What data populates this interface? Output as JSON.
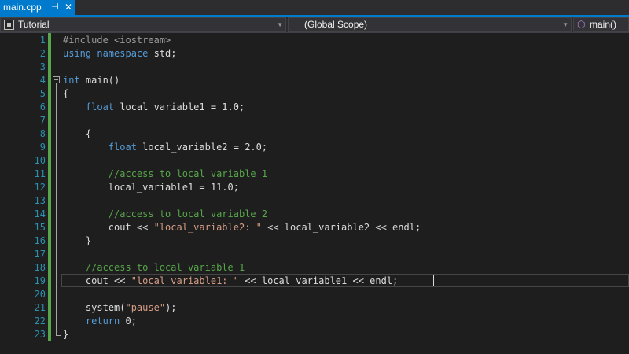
{
  "tab": {
    "title": "main.cpp",
    "pin_glyph": "⊣",
    "close_glyph": "✕"
  },
  "navbar": {
    "project": "Tutorial",
    "scope": "(Global Scope)",
    "member": "main()"
  },
  "colors": {
    "keyword": "#569cd6",
    "preprocessor": "#9b9b9b",
    "string": "#d69d85",
    "comment": "#57a64a",
    "plain": "#dcdcdc",
    "line_number": "#2b91af",
    "accent": "#007acc"
  },
  "icons": {
    "project": "cpp-project-icon",
    "member": "method-cube-icon",
    "collapse": "collapse-minus-icon",
    "tab_pin": "pin-icon",
    "tab_close": "close-icon",
    "dropdown": "chevron-down-icon"
  },
  "editor": {
    "current_line": 19,
    "lines": [
      {
        "n": "1",
        "tokens": [
          {
            "t": "#include <iostream>",
            "c": "pp"
          }
        ]
      },
      {
        "n": "2",
        "tokens": [
          {
            "t": "using namespace",
            "c": "kw"
          },
          {
            "t": " std;",
            "c": "pl"
          }
        ]
      },
      {
        "n": "3",
        "tokens": []
      },
      {
        "n": "4",
        "tokens": [
          {
            "t": "int",
            "c": "kw"
          },
          {
            "t": " main()",
            "c": "pl"
          }
        ]
      },
      {
        "n": "5",
        "tokens": [
          {
            "t": "{",
            "c": "pl"
          }
        ]
      },
      {
        "n": "6",
        "tokens": [
          {
            "t": "    ",
            "c": "pl"
          },
          {
            "t": "float",
            "c": "kw"
          },
          {
            "t": " local_variable1 = 1.0;",
            "c": "pl"
          }
        ]
      },
      {
        "n": "7",
        "tokens": []
      },
      {
        "n": "8",
        "tokens": [
          {
            "t": "    {",
            "c": "pl"
          }
        ]
      },
      {
        "n": "9",
        "tokens": [
          {
            "t": "        ",
            "c": "pl"
          },
          {
            "t": "float",
            "c": "kw"
          },
          {
            "t": " local_variable2 = 2.0;",
            "c": "pl"
          }
        ]
      },
      {
        "n": "10",
        "tokens": []
      },
      {
        "n": "11",
        "tokens": [
          {
            "t": "        //access to local variable 1",
            "c": "cm"
          }
        ]
      },
      {
        "n": "12",
        "tokens": [
          {
            "t": "        local_variable1 = 11.0;",
            "c": "pl"
          }
        ]
      },
      {
        "n": "13",
        "tokens": []
      },
      {
        "n": "14",
        "tokens": [
          {
            "t": "        //access to local variable 2",
            "c": "cm"
          }
        ]
      },
      {
        "n": "15",
        "tokens": [
          {
            "t": "        cout << ",
            "c": "pl"
          },
          {
            "t": "\"local_variable2: \"",
            "c": "str"
          },
          {
            "t": " << local_variable2 << endl;",
            "c": "pl"
          }
        ]
      },
      {
        "n": "16",
        "tokens": [
          {
            "t": "    }",
            "c": "pl"
          }
        ]
      },
      {
        "n": "17",
        "tokens": []
      },
      {
        "n": "18",
        "tokens": [
          {
            "t": "    //access to local variable 1",
            "c": "cm"
          }
        ]
      },
      {
        "n": "19",
        "tokens": [
          {
            "t": "    cout << ",
            "c": "pl"
          },
          {
            "t": "\"local_variable1: \"",
            "c": "str"
          },
          {
            "t": " << local_variable1 << endl;",
            "c": "pl"
          }
        ]
      },
      {
        "n": "20",
        "tokens": []
      },
      {
        "n": "21",
        "tokens": [
          {
            "t": "    system(",
            "c": "pl"
          },
          {
            "t": "\"pause\"",
            "c": "str"
          },
          {
            "t": ");",
            "c": "pl"
          }
        ]
      },
      {
        "n": "22",
        "tokens": [
          {
            "t": "    ",
            "c": "pl"
          },
          {
            "t": "return",
            "c": "kw"
          },
          {
            "t": " 0;",
            "c": "pl"
          }
        ]
      },
      {
        "n": "23",
        "tokens": [
          {
            "t": "}",
            "c": "pl"
          }
        ]
      }
    ]
  }
}
